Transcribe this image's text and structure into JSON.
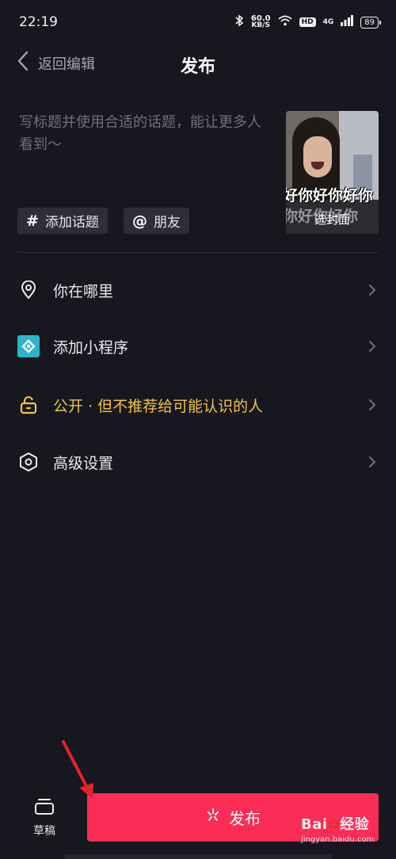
{
  "status_bar": {
    "time": "22:19",
    "net_speed": "60.0",
    "net_unit": "KB/S",
    "hd": "HD",
    "network": "4G",
    "battery": "89"
  },
  "header": {
    "back_label": "返回编辑",
    "title": "发布"
  },
  "caption": {
    "placeholder": "写标题并使用合适的话题，能让更多人看到～"
  },
  "cover": {
    "meme_text": "好你好你好你",
    "meme_text_echo": "你好你好你",
    "label": "选封面"
  },
  "chips": [
    {
      "symbol": "#",
      "label": "添加话题"
    },
    {
      "symbol": "@",
      "label": "朋友"
    }
  ],
  "options": [
    {
      "label": "你在哪里",
      "icon": "location-pin-icon",
      "color": "#e9e9ee"
    },
    {
      "label": "添加小程序",
      "icon": "mini-program-icon",
      "color": "#e9e9ee"
    },
    {
      "label": "公开 · 但不推荐给可能认识的人",
      "icon": "unlock-icon",
      "color": "#f3c341"
    },
    {
      "label": "高级设置",
      "icon": "settings-hexagon-icon",
      "color": "#e9e9ee"
    }
  ],
  "bottom": {
    "draft_label": "草稿",
    "publish_label": "发布"
  },
  "watermark": {
    "brand_a": "Bai",
    "brand_b": "经验",
    "url": "jingyan.baidu.com"
  },
  "colors": {
    "background": "#16171f",
    "publish": "#fb2c55",
    "accent_yellow": "#f3c341",
    "mini_program": "#2bb5c9",
    "annotation_arrow": "#e3242b"
  }
}
